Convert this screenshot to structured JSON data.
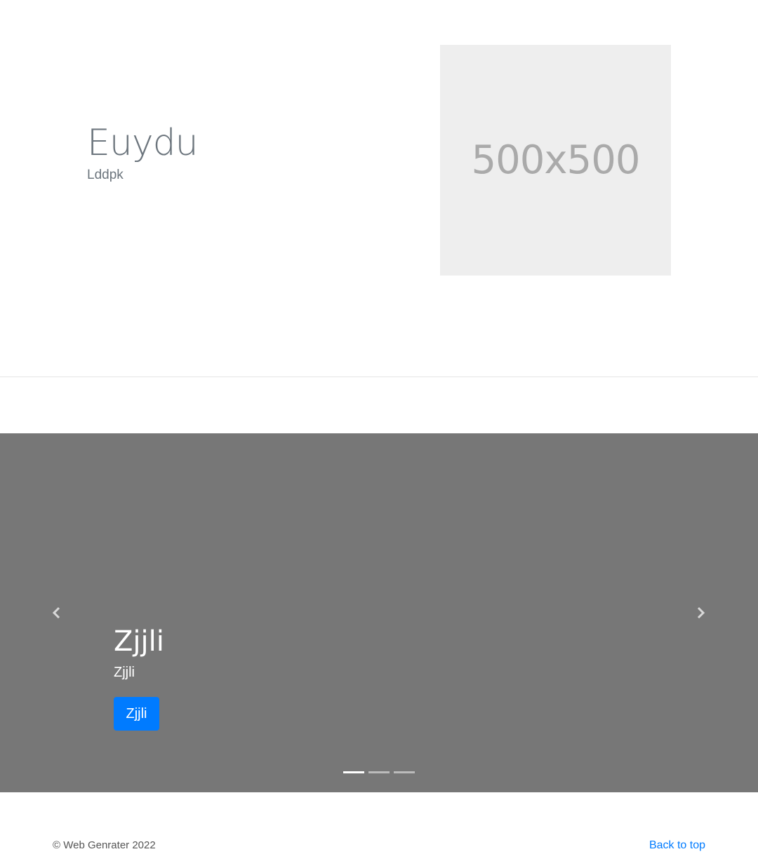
{
  "hero": {
    "title": "Euydu",
    "subtitle": "Lddpk",
    "image_placeholder": "500x500"
  },
  "carousel": {
    "slide": {
      "title": "Zjjli",
      "text": "Zjjli",
      "button_label": "Zjjli"
    },
    "controls": {
      "prev_icon": "chevron-left-icon",
      "next_icon": "chevron-right-icon"
    },
    "indicators": [
      {
        "active": true
      },
      {
        "active": false
      },
      {
        "active": false
      }
    ],
    "background_color": "#777777",
    "button_color": "#007bff"
  },
  "footer": {
    "copyright": "© Web Genrater 2022",
    "back_to_top": "Back to top"
  }
}
